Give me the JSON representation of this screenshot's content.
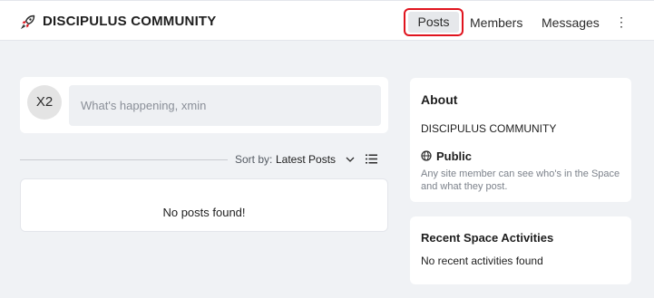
{
  "header": {
    "logo_icon": "rocket-icon",
    "brand": "DISCIPULUS COMMUNITY",
    "nav": {
      "posts": "Posts",
      "members": "Members",
      "messages": "Messages",
      "more": "⋮"
    }
  },
  "composer": {
    "avatar_initials": "X2",
    "placeholder": "What's happening, xmin"
  },
  "feed": {
    "sort_label": "Sort by:",
    "sort_value": "Latest Posts",
    "empty_text": "No posts found!"
  },
  "sidebar": {
    "about": {
      "title": "About",
      "name": "DISCIPULUS COMMUNITY",
      "privacy_icon": "globe-icon",
      "privacy_label": "Public",
      "privacy_desc": "Any site member can see who's in the Space and what they post."
    },
    "activities": {
      "title": "Recent Space Activities",
      "empty_text": "No recent activities found"
    }
  },
  "colors": {
    "highlight_border": "#e0141e",
    "page_bg": "#f0f2f5"
  }
}
